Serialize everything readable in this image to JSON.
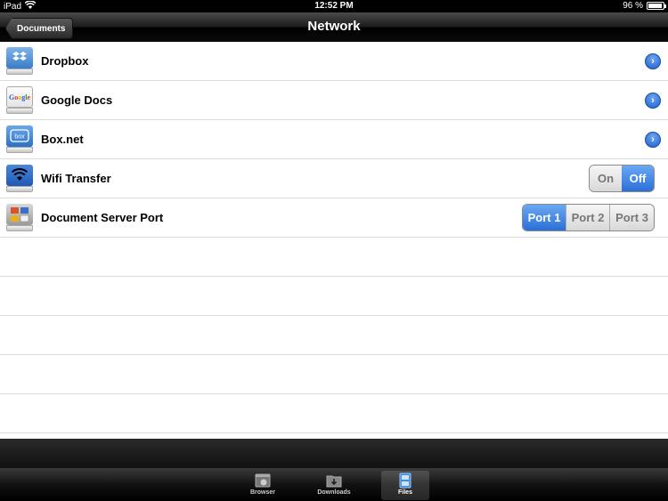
{
  "statusbar": {
    "carrier": "iPad",
    "time": "12:52 PM",
    "battery": "96 %",
    "battery_level": 0.96
  },
  "navbar": {
    "back_label": "Documents",
    "title": "Network"
  },
  "rows": [
    {
      "label": "Dropbox",
      "icon": "dropbox-icon",
      "accessory": "disclosure"
    },
    {
      "label": "Google Docs",
      "icon": "google-docs-icon",
      "accessory": "disclosure"
    },
    {
      "label": "Box.net",
      "icon": "box-net-icon",
      "accessory": "disclosure"
    },
    {
      "label": "Wifi Transfer",
      "icon": "wifi-icon",
      "accessory": "toggle"
    },
    {
      "label": "Document Server Port",
      "icon": "document-server-icon",
      "accessory": "segmented"
    }
  ],
  "toggle": {
    "on_label": "On",
    "off_label": "Off",
    "selected": "Off"
  },
  "port_segmented": {
    "options": [
      "Port 1",
      "Port 2",
      "Port 3"
    ],
    "selected": "Port 1"
  },
  "tabbar": {
    "items": [
      {
        "label": "Browser",
        "icon": "browser-icon",
        "active": false
      },
      {
        "label": "Downloads",
        "icon": "downloads-icon",
        "active": false
      },
      {
        "label": "Files",
        "icon": "files-icon",
        "active": true
      }
    ]
  },
  "colors": {
    "accent": "#2a6fd6",
    "navbar": "#1a1a1a",
    "separator": "#dcdcdc"
  }
}
